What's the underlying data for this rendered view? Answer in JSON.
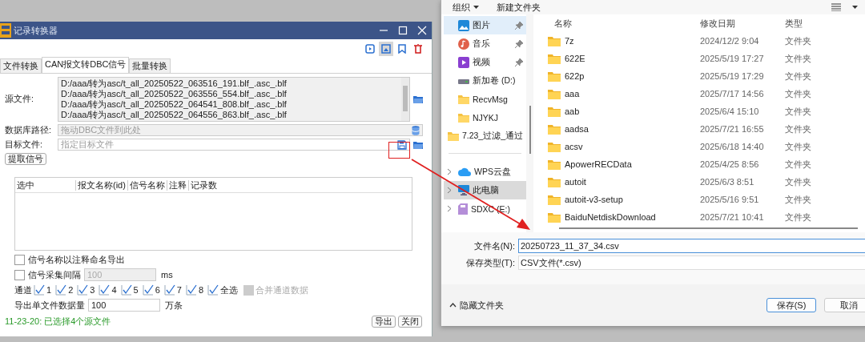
{
  "left_window": {
    "title": "记录转换器",
    "toolbar_buttons": [
      {
        "kind": "play",
        "selected": false
      },
      {
        "kind": "image",
        "selected": true
      },
      {
        "kind": "bookmark",
        "selected": false
      },
      {
        "kind": "delete",
        "selected": false
      }
    ],
    "tabs": [
      {
        "label": "文件转换",
        "selected": false
      },
      {
        "label": "CAN报文转DBC信号",
        "selected": true
      },
      {
        "label": "批量转换",
        "selected": false
      }
    ],
    "source_files": {
      "label": "源文件:",
      "lines": [
        "D:/aaa/转为asc/t_all_20250522_063516_191.blf_.asc_.blf",
        "D:/aaa/转为asc/t_all_20250522_063556_554.blf_.asc_.blf",
        "D:/aaa/转为asc/t_all_20250522_064541_808.blf_.asc_.blf",
        "D:/aaa/转为asc/t_all_20250522_064556_863.blf_.asc_.blf"
      ]
    },
    "database_path": {
      "label": "数据库路径:",
      "placeholder": "拖动DBC文件到此处"
    },
    "target_file": {
      "label": "目标文件:",
      "placeholder": "指定目标文件"
    },
    "extract_button": "提取信号",
    "table": {
      "columns": [
        "选中",
        "报文名称(id)",
        "信号名称",
        "注释",
        "记录数"
      ]
    },
    "export_by_comment": {
      "label": "信号名称以注释命名导出",
      "checked": false
    },
    "sample_interval": {
      "label": "信号采集间隔",
      "checked": false,
      "value": "100",
      "unit": "ms"
    },
    "channels": {
      "label": "通道",
      "items": [
        {
          "label": "1",
          "checked": true
        },
        {
          "label": "2",
          "checked": true
        },
        {
          "label": "3",
          "checked": true
        },
        {
          "label": "4",
          "checked": true
        },
        {
          "label": "5",
          "checked": true
        },
        {
          "label": "6",
          "checked": true
        },
        {
          "label": "7",
          "checked": true
        },
        {
          "label": "8",
          "checked": true
        }
      ],
      "select_all": {
        "label": "全选",
        "checked": true
      },
      "merge": {
        "label": "合并通道数据",
        "checked": false,
        "disabled": true
      }
    },
    "export_size": {
      "label": "导出单文件数据量",
      "value": "100",
      "unit": "万条"
    },
    "status": "11-23-20: 已选择4个源文件",
    "buttons": [
      "导出",
      "关闭"
    ]
  },
  "save_dialog": {
    "toolbar": {
      "organize": "组织",
      "new_folder": "新建文件夹"
    },
    "sidebar": [
      {
        "label": "图片",
        "kind": "picture",
        "pinned": true,
        "hovered": true,
        "selected": false
      },
      {
        "label": "音乐",
        "kind": "music",
        "pinned": true,
        "hovered": false,
        "selected": false
      },
      {
        "label": "视频",
        "kind": "video",
        "pinned": true,
        "hovered": false,
        "selected": false
      },
      {
        "label": "新加卷 (D:)",
        "kind": "drive",
        "pinned": false,
        "hovered": false,
        "selected": false
      },
      {
        "label": "RecvMsg",
        "kind": "folder",
        "pinned": false,
        "hovered": false,
        "selected": false
      },
      {
        "label": "NJYKJ",
        "kind": "folder",
        "pinned": false,
        "hovered": false,
        "selected": false
      },
      {
        "label": "7.23_过滤_通过",
        "kind": "folder",
        "pinned": false,
        "hovered": false,
        "selected": false
      },
      {
        "label": "WPS云盘",
        "kind": "cloud",
        "pinned": false,
        "hovered": false,
        "selected": false,
        "expanded": false,
        "divider_before": true
      },
      {
        "label": "此电脑",
        "kind": "computer",
        "pinned": false,
        "hovered": false,
        "selected": true,
        "expanded": false
      },
      {
        "label": "SDXC (E:)",
        "kind": "sdcard",
        "pinned": false,
        "hovered": false,
        "selected": false,
        "expanded": false
      }
    ],
    "columns": [
      "名称",
      "修改日期",
      "类型"
    ],
    "files": [
      {
        "name": "7z",
        "modified": "2024/12/2 9:04",
        "type": "文件夹"
      },
      {
        "name": "622E",
        "modified": "2025/5/19 17:27",
        "type": "文件夹"
      },
      {
        "name": "622p",
        "modified": "2025/5/19 17:29",
        "type": "文件夹"
      },
      {
        "name": "aaa",
        "modified": "2025/7/17 14:56",
        "type": "文件夹"
      },
      {
        "name": "aab",
        "modified": "2025/6/4 15:10",
        "type": "文件夹"
      },
      {
        "name": "aadsa",
        "modified": "2025/7/21 16:55",
        "type": "文件夹"
      },
      {
        "name": "acsv",
        "modified": "2025/6/18 14:40",
        "type": "文件夹"
      },
      {
        "name": "ApowerRECData",
        "modified": "2025/4/25 8:56",
        "type": "文件夹"
      },
      {
        "name": "autoit",
        "modified": "2025/6/3 8:51",
        "type": "文件夹"
      },
      {
        "name": "autoit-v3-setup",
        "modified": "2025/5/16 9:51",
        "type": "文件夹"
      },
      {
        "name": "BaiduNetdiskDownload",
        "modified": "2025/7/21 10:41",
        "type": "文件夹"
      }
    ],
    "file_name": {
      "label": "文件名(N):",
      "value": "20250723_11_37_34.csv"
    },
    "save_type": {
      "label": "保存类型(T):",
      "value": "CSV文件(*.csv)"
    },
    "hide_folders": "隐藏文件夹",
    "buttons": [
      "保存(S)",
      "取消"
    ]
  }
}
